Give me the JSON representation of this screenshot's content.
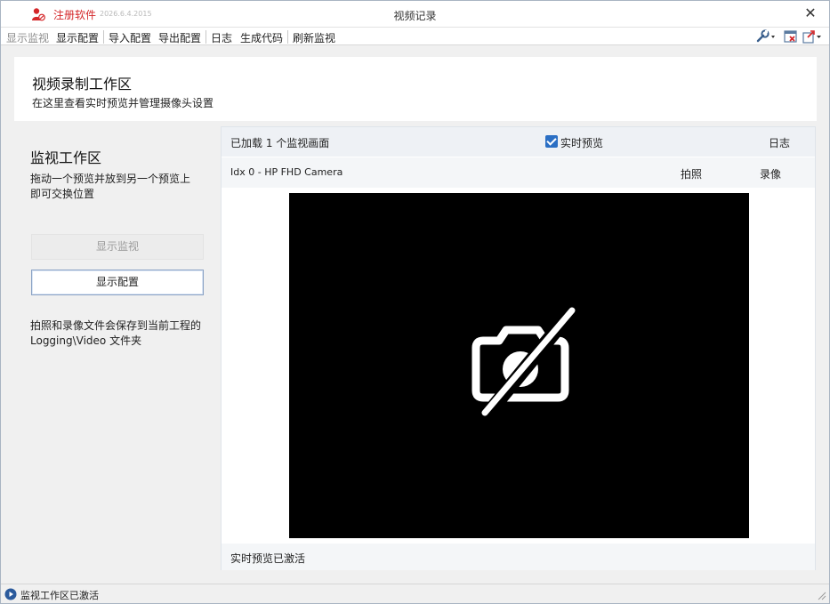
{
  "titlebar": {
    "register_label": "注册软件",
    "version": "2026.6.4.2015",
    "title": "视频记录",
    "close_glyph": "✕"
  },
  "menubar": {
    "items": [
      "显示监视",
      "显示配置",
      "导入配置",
      "导出配置",
      "日志",
      "生成代码",
      "刷新监视"
    ],
    "icons": [
      "wrench-dropdown-icon",
      "window-close-icon",
      "export-dropdown-icon"
    ]
  },
  "header": {
    "title": "视频录制工作区",
    "subtitle": "在这里查看实时预览并管理摄像头设置"
  },
  "left_panel": {
    "title": "监视工作区",
    "description": "拖动一个预览并放到另一个预览上即可交换位置",
    "show_monitor_button": "显示监视",
    "show_config_button": "显示配置",
    "note": "拍照和录像文件会保存到当前工程的 Logging\\Video 文件夹"
  },
  "monitor": {
    "loaded_text": "已加载 1 个监视画面",
    "live_preview_label": "实时预览",
    "live_preview_checked": true,
    "log_label": "日志",
    "camera_name": "Idx 0 - HP FHD Camera",
    "photo_label": "拍照",
    "record_label": "录像",
    "status_text": "实时预览已激活"
  },
  "statusbar": {
    "text": "监视工作区已激活"
  },
  "colors": {
    "accent": "#2b6fc4",
    "register_red": "#d4272a",
    "video_bg": "#000000"
  }
}
